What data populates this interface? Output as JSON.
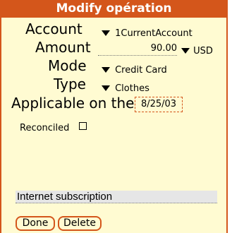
{
  "title": "Modify opération",
  "account": {
    "label": "Account",
    "value": "1CurrentAccount"
  },
  "amount": {
    "label": "Amount",
    "value": "90.00",
    "currency": "USD"
  },
  "mode": {
    "label": "Mode",
    "value": "Credit Card"
  },
  "type": {
    "label": "Type",
    "value": "Clothes"
  },
  "date": {
    "label": "Applicable on the",
    "value": "8/25/03"
  },
  "reconciled": {
    "label": "Reconciled",
    "checked": false
  },
  "note": "Internet subscription",
  "buttons": {
    "done": "Done",
    "delete": "Delete"
  },
  "colors": {
    "accent": "#d4561b",
    "background": "#fffbd2"
  }
}
